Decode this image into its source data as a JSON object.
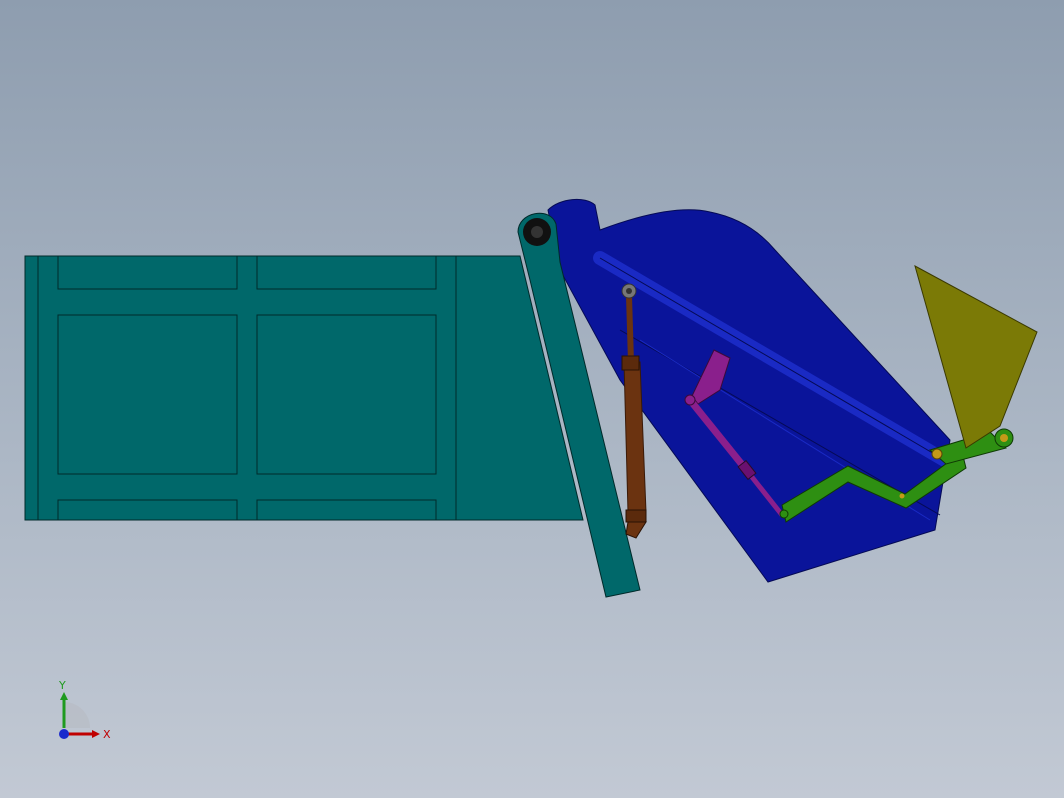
{
  "triad": {
    "x_label": "X",
    "y_label": "Y"
  },
  "colors": {
    "background_top": "#8e9daf",
    "background_bottom": "#c2c9d4",
    "frame": "#00686a",
    "hopper": "#0a149a",
    "cylinder": "#6b3310",
    "link_purple": "#8a1f8c",
    "lever_green": "#2e8f12",
    "blade": "#7b7a06",
    "axis_x": "#c00000",
    "axis_y": "#1f9a1f",
    "axis_z": "#1a2acc"
  }
}
